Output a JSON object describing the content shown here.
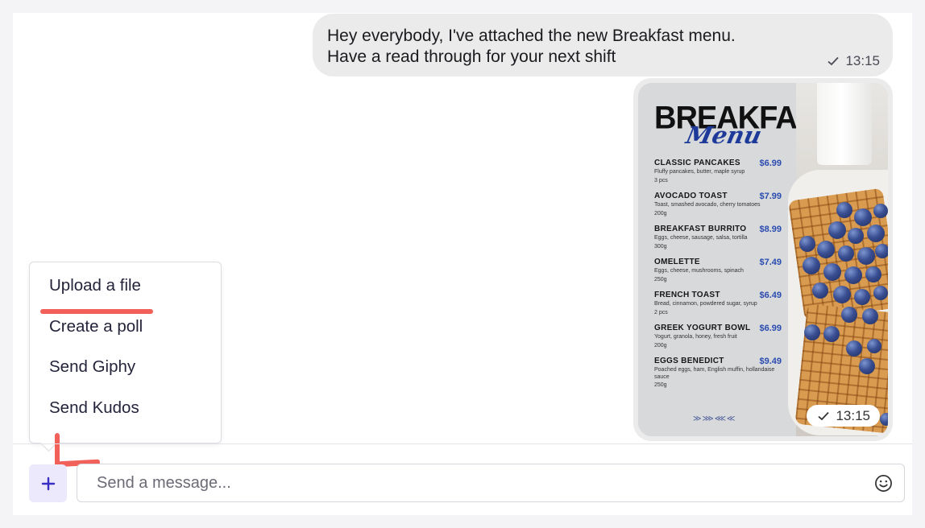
{
  "messages": {
    "text_message": {
      "line1": "Hey everybody, I've attached the new Breakfast menu.",
      "line2": "Have a read through for your next shift",
      "time": "13:15",
      "status_icon": "check-icon"
    },
    "image_message": {
      "time": "13:15",
      "status_icon": "check-icon",
      "menu": {
        "title": "BREAKFAST",
        "script": "Menu",
        "items": [
          {
            "name": "CLASSIC PANCAKES",
            "price": "$6.99",
            "desc": "Fluffy pancakes, butter, maple syrup",
            "qty": "3 pcs"
          },
          {
            "name": "AVOCADO TOAST",
            "price": "$7.99",
            "desc": "Toast, smashed avocado, cherry tomatoes",
            "qty": "200g"
          },
          {
            "name": "BREAKFAST BURRITO",
            "price": "$8.99",
            "desc": "Eggs, cheese, sausage, salsa, tortilla",
            "qty": "300g"
          },
          {
            "name": "OMELETTE",
            "price": "$7.49",
            "desc": "Eggs, cheese, mushrooms, spinach",
            "qty": "250g"
          },
          {
            "name": "FRENCH TOAST",
            "price": "$6.49",
            "desc": "Bread, cinnamon, powdered sugar, syrup",
            "qty": "2 pcs"
          },
          {
            "name": "GREEK YOGURT BOWL",
            "price": "$6.99",
            "desc": "Yogurt, granola, honey, fresh fruit",
            "qty": "200g"
          },
          {
            "name": "EGGS BENEDICT",
            "price": "$9.49",
            "desc": "Poached eggs, ham, English muffin, hollandaise sauce",
            "qty": "250g"
          }
        ]
      }
    }
  },
  "popup_menu": {
    "items": [
      {
        "label": "Upload a file"
      },
      {
        "label": "Create a poll"
      },
      {
        "label": "Send Giphy"
      },
      {
        "label": "Send Kudos"
      }
    ]
  },
  "composer": {
    "plus_icon": "plus-icon",
    "placeholder": "Send a message...",
    "emoji_icon": "smiley-icon"
  },
  "colors": {
    "accent": "#3a2fc4",
    "annotation": "#f2605a",
    "bubble": "#ebebeb",
    "menu_price": "#2a4bb0"
  }
}
